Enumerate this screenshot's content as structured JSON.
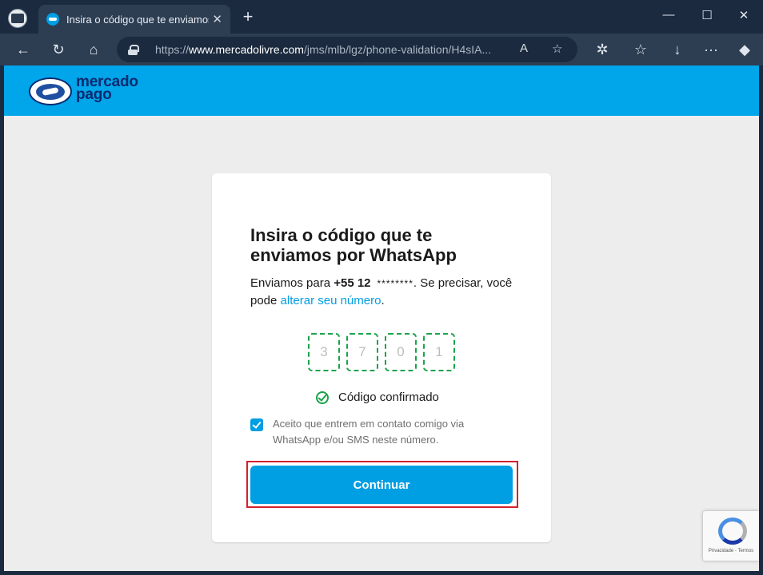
{
  "browser": {
    "tab_title": "Insira o código que te enviamos por WhatsApp",
    "url_prefix": "https://",
    "url_host": "www.mercadolivre.com",
    "url_path": "/jms/mlb/lgz/phone-validation/H4sIA..."
  },
  "header": {
    "brand_line1": "mercado",
    "brand_line2": "pago"
  },
  "card": {
    "title": "Insira o código que te enviamos por WhatsApp",
    "desc_prefix": "Enviamos para ",
    "phone_prefix": "+55 12",
    "phone_mask": "********",
    "desc_middle": ". Se precisar, você pode ",
    "change_link": "alterar seu número",
    "desc_suffix": ".",
    "code_digits": [
      "3",
      "7",
      "0",
      "1"
    ],
    "confirmed_text": "Código confirmado",
    "consent_text": "Aceito que entrem em contato comigo via WhatsApp e/ou SMS neste número.",
    "continue_label": "Continuar"
  },
  "recaptcha": {
    "footer": "Privacidade - Termos"
  },
  "colors": {
    "brand_blue": "#009ee3",
    "header_blue": "#00a5ea",
    "success_green": "#1aa34a",
    "highlight_red": "#d4202c"
  }
}
